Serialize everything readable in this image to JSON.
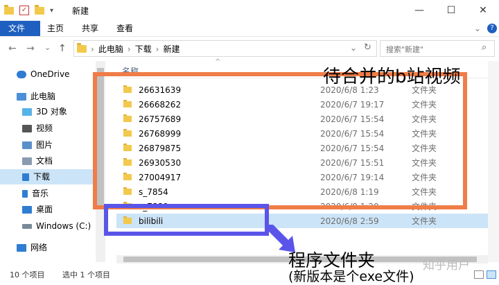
{
  "window": {
    "title": "新建",
    "qat_dropdown": "▾",
    "controls": {
      "minimize": "—",
      "maximize": "☐",
      "close": "✕"
    }
  },
  "ribbon": {
    "tabs": [
      {
        "label": "文件"
      },
      {
        "label": "主页"
      },
      {
        "label": "共享"
      },
      {
        "label": "查看"
      }
    ],
    "expand": "⌄",
    "help": "?"
  },
  "nav_buttons": {
    "back": "←",
    "forward": "→",
    "history": "⌄",
    "up": "↑"
  },
  "address": {
    "crumbs": [
      "此电脑",
      "下载",
      "新建"
    ],
    "sep": "›",
    "dropdown": "⌄",
    "refresh": "↻"
  },
  "search": {
    "placeholder": "搜索\"新建\"",
    "icon": "⌕"
  },
  "nav_pane": {
    "items": [
      {
        "label": "OneDrive",
        "icon": "cloud-icon",
        "color": "#2f7dd1"
      },
      {
        "label": "此电脑",
        "icon": "computer-icon",
        "color": "#4a90d9"
      },
      {
        "label": "3D 对象",
        "icon": "cube-icon",
        "color": "#57b3e6"
      },
      {
        "label": "视频",
        "icon": "video-icon",
        "color": "#555555"
      },
      {
        "label": "图片",
        "icon": "pictures-icon",
        "color": "#5b8fc9"
      },
      {
        "label": "文档",
        "icon": "documents-icon",
        "color": "#8a9bb0"
      },
      {
        "label": "下载",
        "icon": "download-icon",
        "color": "#2f7dd1",
        "selected": true
      },
      {
        "label": "音乐",
        "icon": "music-icon",
        "color": "#2f7dd1"
      },
      {
        "label": "桌面",
        "icon": "desktop-icon",
        "color": "#2f7dd1"
      },
      {
        "label": "Windows (C:)",
        "icon": "drive-icon",
        "color": "#7a8a99"
      },
      {
        "label": "网络",
        "icon": "network-icon",
        "color": "#2f7dd1"
      }
    ]
  },
  "file_list": {
    "header": {
      "name": "名称",
      "sort_arrow": "^"
    },
    "rows": [
      {
        "name": "26631639",
        "date": "2020/6/8 1:23",
        "type": "文件夹"
      },
      {
        "name": "26668262",
        "date": "2020/6/7 19:17",
        "type": "文件夹"
      },
      {
        "name": "26757689",
        "date": "2020/6/7 15:54",
        "type": "文件夹"
      },
      {
        "name": "26768999",
        "date": "2020/6/7 15:54",
        "type": "文件夹"
      },
      {
        "name": "26879875",
        "date": "2020/6/7 15:54",
        "type": "文件夹"
      },
      {
        "name": "26930530",
        "date": "2020/6/7 15:51",
        "type": "文件夹"
      },
      {
        "name": "27004917",
        "date": "2020/6/7 19:14",
        "type": "文件夹"
      },
      {
        "name": "s_7854",
        "date": "2020/6/8 1:19",
        "type": "文件夹"
      },
      {
        "name": "s_7880",
        "date": "2020/6/8 1:20",
        "type": "文件夹"
      },
      {
        "name": "bilibili",
        "date": "2020/6/8 2:59",
        "type": "文件夹",
        "selected": true
      }
    ]
  },
  "status": {
    "count": "10 个项目",
    "selected": "选中 1 个项目"
  },
  "annotations": {
    "title": "待合并的b站视频",
    "program": "程序文件夹",
    "program_sub": "(新版本是个exe文件)",
    "watermark": "知乎用户"
  },
  "colors": {
    "accent": "#1f5fbf",
    "orange_box": "#ef7d47",
    "blue_box": "#5a55e8",
    "selection": "#cce4f7"
  }
}
